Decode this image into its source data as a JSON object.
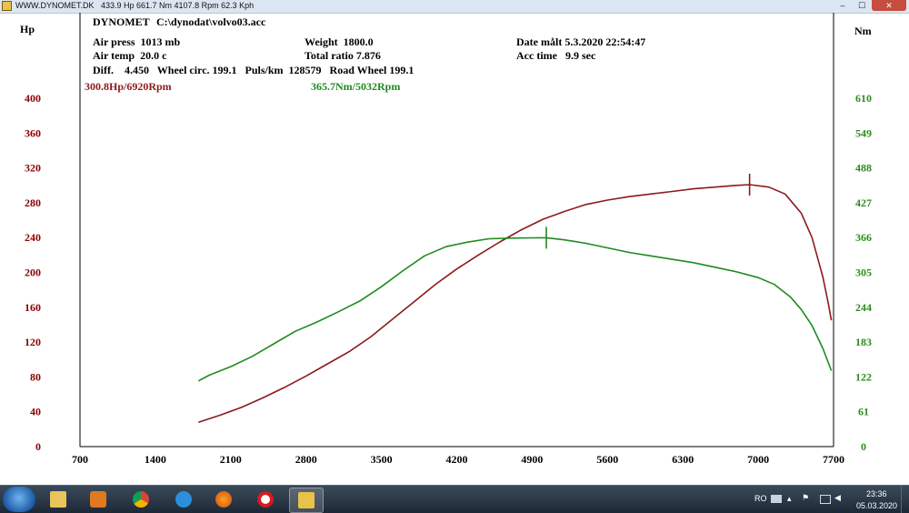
{
  "window": {
    "title": "WWW.DYNOMET.DK   433.9 Hp 661.7 Nm 4107.8 Rpm 62.3 Kph",
    "min_label": "–",
    "max_label": "☐",
    "close_label": "✕"
  },
  "header": {
    "app_name": "DYNOMET",
    "file_path": "C:\\dynodat\\volvo03.acc",
    "air_press": "Air press  1013 mb",
    "air_temp": "Air temp  20.0 c",
    "diff_line": "Diff.    4.450   Wheel circ. 199.1   Puls/km  128579   Road Wheel 199.1",
    "weight": "Weight  1800.0",
    "total_ratio": "Total ratio 7.876",
    "date": "Date målt 5.3.2020 22:54:47",
    "acc_time": "Acc time   9.9 sec"
  },
  "peaks": {
    "power": "300.8Hp/6920Rpm",
    "torque": "365.7Nm/5032Rpm"
  },
  "chart_data": {
    "type": "line",
    "x_ticks": [
      700,
      1400,
      2100,
      2800,
      3500,
      4200,
      4900,
      5600,
      6300,
      7000,
      7700
    ],
    "xlim": [
      700,
      7700
    ],
    "y_left": {
      "label": "Hp",
      "ticks": [
        0,
        40,
        80,
        120,
        160,
        200,
        240,
        280,
        320,
        360,
        400
      ],
      "range": [
        0,
        400
      ],
      "color": "#8b0000"
    },
    "y_right": {
      "label": "Nm",
      "ticks": [
        0,
        61,
        122,
        183,
        244,
        305,
        366,
        427,
        488,
        549,
        610
      ],
      "range": [
        0,
        610
      ],
      "color": "#2e8b1e"
    },
    "grid": false,
    "series": [
      {
        "name": "Hp",
        "axis": "left",
        "color": "#8b1a1a",
        "x": [
          1800,
          2000,
          2200,
          2400,
          2600,
          2800,
          3000,
          3200,
          3400,
          3600,
          3800,
          4000,
          4200,
          4400,
          4600,
          4800,
          5000,
          5200,
          5400,
          5600,
          5800,
          6000,
          6200,
          6400,
          6600,
          6800,
          6920,
          7100,
          7250,
          7400,
          7500,
          7600,
          7650,
          7680
        ],
        "y": [
          28,
          36,
          45,
          56,
          68,
          81,
          95,
          109,
          126,
          146,
          166,
          186,
          204,
          220,
          235,
          249,
          261,
          270,
          278,
          283,
          287,
          290,
          293,
          296,
          298,
          300,
          300.8,
          298,
          290,
          268,
          240,
          195,
          165,
          145
        ]
      },
      {
        "name": "Nm",
        "axis": "right",
        "color": "#1f8a1f",
        "x": [
          1800,
          1900,
          2100,
          2300,
          2500,
          2700,
          2900,
          3100,
          3300,
          3500,
          3700,
          3900,
          4100,
          4300,
          4500,
          4700,
          4900,
          5032,
          5200,
          5400,
          5600,
          5800,
          6000,
          6200,
          6400,
          6600,
          6800,
          7000,
          7150,
          7300,
          7400,
          7500,
          7600,
          7680
        ],
        "y": [
          115,
          125,
          140,
          158,
          180,
          202,
          218,
          236,
          255,
          280,
          308,
          334,
          350,
          358,
          364,
          365,
          365.5,
          365.7,
          362,
          356,
          348,
          340,
          334,
          328,
          322,
          314,
          306,
          296,
          284,
          262,
          240,
          212,
          172,
          133
        ]
      }
    ],
    "markers": [
      {
        "series": "Hp",
        "x": 6920,
        "y": 300.8
      },
      {
        "series": "Nm",
        "x": 5032,
        "y": 365.7
      }
    ]
  },
  "taskbar": {
    "lang": "RO",
    "time": "23:36",
    "date": "05.03.2020",
    "apps": [
      "file-explorer",
      "media-player",
      "chrome",
      "internet-explorer",
      "firefox",
      "opera",
      "dynomet"
    ]
  }
}
